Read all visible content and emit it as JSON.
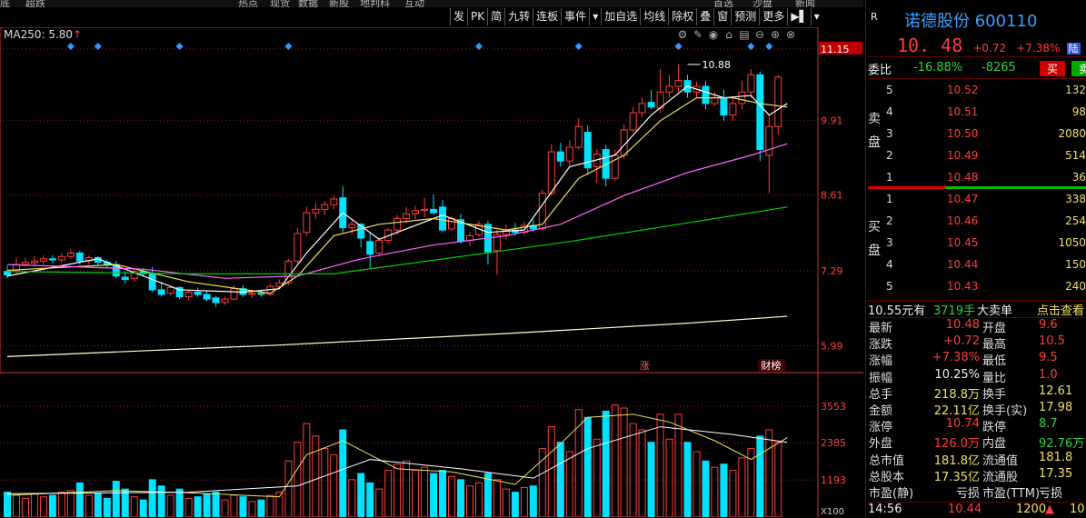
{
  "top_strip": [
    "底",
    "超跌",
    "热点",
    "现货",
    "数据",
    "新股",
    "地判科",
    "互动",
    "首选",
    "沙盘",
    "新闻"
  ],
  "toolbar": [
    {
      "id": "fa",
      "label": "发"
    },
    {
      "id": "pk",
      "label": "PK"
    },
    {
      "id": "jian",
      "label": "简"
    },
    {
      "id": "jiuzhuan",
      "label": "九转"
    },
    {
      "id": "lianban",
      "label": "连板"
    },
    {
      "id": "shijian",
      "label": "事件"
    },
    {
      "id": "menu",
      "label": "▾"
    },
    {
      "id": "jiazixuan",
      "label": "加自选"
    },
    {
      "id": "junxian",
      "label": "均线"
    },
    {
      "id": "chuquan",
      "label": "除权"
    },
    {
      "id": "die",
      "label": "叠"
    },
    {
      "id": "chuang",
      "label": "窗"
    },
    {
      "id": "yuce",
      "label": "预测"
    },
    {
      "id": "gengduo",
      "label": "更多"
    },
    {
      "id": "expand",
      "label": "▶▌"
    },
    {
      "id": "dropdown",
      "label": "▾"
    }
  ],
  "ma250_label": "MA250: 5.80",
  "ma250_arrow": "↑",
  "chart_controls": [
    "gear-icon",
    "pen-icon",
    "eye-icon",
    "lock-icon",
    "print-icon",
    "minus-icon",
    "plus-icon",
    "close-icon"
  ],
  "colors": {
    "up": "#ff3c3c",
    "down": "#00e0ff",
    "ma5": "#ffffff",
    "ma10": "#f0e060",
    "ma20": "#ff66ff",
    "ma60": "#00d000",
    "ma250": "#ffffcc",
    "grid": "#9a2020",
    "axis": "#cc3333"
  },
  "chart_data": {
    "type": "candlestick",
    "price_ticks": [
      11.15,
      9.91,
      8.61,
      7.29,
      5.99
    ],
    "price_range": [
      5.6,
      11.4
    ],
    "volume_ticks": [
      3553,
      2385,
      1193
    ],
    "volume_unit": "X100",
    "volume_range": [
      0,
      4200
    ],
    "high_marker": "10.88",
    "annotations": [
      "涨",
      "财榜"
    ],
    "candles": [
      {
        "o": 7.28,
        "h": 7.38,
        "l": 7.16,
        "c": 7.22,
        "v": 800
      },
      {
        "o": 7.3,
        "h": 7.52,
        "l": 7.24,
        "c": 7.4,
        "v": 700
      },
      {
        "o": 7.4,
        "h": 7.52,
        "l": 7.36,
        "c": 7.44,
        "v": 600
      },
      {
        "o": 7.43,
        "h": 7.55,
        "l": 7.38,
        "c": 7.46,
        "v": 750
      },
      {
        "o": 7.46,
        "h": 7.56,
        "l": 7.4,
        "c": 7.5,
        "v": 650
      },
      {
        "o": 7.5,
        "h": 7.56,
        "l": 7.42,
        "c": 7.48,
        "v": 700
      },
      {
        "o": 7.48,
        "h": 7.6,
        "l": 7.44,
        "c": 7.54,
        "v": 800
      },
      {
        "o": 7.54,
        "h": 7.66,
        "l": 7.5,
        "c": 7.6,
        "v": 850
      },
      {
        "o": 7.6,
        "h": 7.64,
        "l": 7.4,
        "c": 7.46,
        "v": 1100
      },
      {
        "o": 7.47,
        "h": 7.56,
        "l": 7.4,
        "c": 7.52,
        "v": 700
      },
      {
        "o": 7.52,
        "h": 7.54,
        "l": 7.38,
        "c": 7.44,
        "v": 750
      },
      {
        "o": 7.44,
        "h": 7.48,
        "l": 7.34,
        "c": 7.4,
        "v": 600
      },
      {
        "o": 7.4,
        "h": 7.46,
        "l": 7.16,
        "c": 7.2,
        "v": 1150
      },
      {
        "o": 7.18,
        "h": 7.28,
        "l": 7.06,
        "c": 7.14,
        "v": 900
      },
      {
        "o": 7.16,
        "h": 7.34,
        "l": 7.1,
        "c": 7.28,
        "v": 650
      },
      {
        "o": 7.28,
        "h": 7.34,
        "l": 7.2,
        "c": 7.24,
        "v": 550
      },
      {
        "o": 7.24,
        "h": 7.36,
        "l": 6.92,
        "c": 6.96,
        "v": 1200
      },
      {
        "o": 6.96,
        "h": 7.1,
        "l": 6.84,
        "c": 6.88,
        "v": 1000
      },
      {
        "o": 6.9,
        "h": 7.04,
        "l": 6.86,
        "c": 7.0,
        "v": 700
      },
      {
        "o": 7.0,
        "h": 7.02,
        "l": 6.8,
        "c": 6.84,
        "v": 900
      },
      {
        "o": 6.84,
        "h": 6.96,
        "l": 6.78,
        "c": 6.92,
        "v": 600
      },
      {
        "o": 6.92,
        "h": 7.0,
        "l": 6.84,
        "c": 6.88,
        "v": 650
      },
      {
        "o": 6.88,
        "h": 6.94,
        "l": 6.76,
        "c": 6.8,
        "v": 750
      },
      {
        "o": 6.82,
        "h": 6.86,
        "l": 6.66,
        "c": 6.74,
        "v": 800
      },
      {
        "o": 6.74,
        "h": 6.84,
        "l": 6.7,
        "c": 6.8,
        "v": 550
      },
      {
        "o": 6.8,
        "h": 7.04,
        "l": 6.78,
        "c": 6.98,
        "v": 700
      },
      {
        "o": 6.98,
        "h": 7.04,
        "l": 6.84,
        "c": 6.88,
        "v": 650
      },
      {
        "o": 6.88,
        "h": 6.96,
        "l": 6.82,
        "c": 6.9,
        "v": 500
      },
      {
        "o": 6.9,
        "h": 6.96,
        "l": 6.84,
        "c": 6.88,
        "v": 550
      },
      {
        "o": 6.88,
        "h": 7.06,
        "l": 6.86,
        "c": 7.02,
        "v": 700
      },
      {
        "o": 7.02,
        "h": 7.14,
        "l": 6.98,
        "c": 7.08,
        "v": 800
      },
      {
        "o": 7.08,
        "h": 7.5,
        "l": 7.04,
        "c": 7.46,
        "v": 1800
      },
      {
        "o": 7.46,
        "h": 8.04,
        "l": 7.42,
        "c": 7.94,
        "v": 2400
      },
      {
        "o": 7.96,
        "h": 8.4,
        "l": 7.9,
        "c": 8.3,
        "v": 3000
      },
      {
        "o": 8.3,
        "h": 8.48,
        "l": 8.2,
        "c": 8.36,
        "v": 2600
      },
      {
        "o": 8.36,
        "h": 8.5,
        "l": 8.26,
        "c": 8.44,
        "v": 2200
      },
      {
        "o": 8.44,
        "h": 8.6,
        "l": 8.36,
        "c": 8.54,
        "v": 2000
      },
      {
        "o": 8.56,
        "h": 8.76,
        "l": 7.96,
        "c": 8.04,
        "v": 2800
      },
      {
        "o": 8.04,
        "h": 8.18,
        "l": 7.92,
        "c": 8.1,
        "v": 1200
      },
      {
        "o": 8.1,
        "h": 8.12,
        "l": 7.7,
        "c": 7.86,
        "v": 1400
      },
      {
        "o": 7.8,
        "h": 7.94,
        "l": 7.34,
        "c": 7.58,
        "v": 1100
      },
      {
        "o": 7.6,
        "h": 7.86,
        "l": 7.56,
        "c": 7.82,
        "v": 900
      },
      {
        "o": 7.82,
        "h": 8.04,
        "l": 7.76,
        "c": 8.0,
        "v": 1500
      },
      {
        "o": 8.0,
        "h": 8.26,
        "l": 7.92,
        "c": 8.2,
        "v": 1700
      },
      {
        "o": 8.2,
        "h": 8.4,
        "l": 8.12,
        "c": 8.28,
        "v": 1800
      },
      {
        "o": 8.28,
        "h": 8.42,
        "l": 8.18,
        "c": 8.34,
        "v": 1500
      },
      {
        "o": 8.34,
        "h": 8.56,
        "l": 8.22,
        "c": 8.36,
        "v": 1600
      },
      {
        "o": 8.36,
        "h": 8.62,
        "l": 8.26,
        "c": 8.3,
        "v": 1400
      },
      {
        "o": 8.4,
        "h": 8.52,
        "l": 7.96,
        "c": 8.0,
        "v": 1500
      },
      {
        "o": 8.02,
        "h": 8.24,
        "l": 7.98,
        "c": 8.2,
        "v": 1300
      },
      {
        "o": 8.18,
        "h": 8.28,
        "l": 7.76,
        "c": 7.8,
        "v": 1200
      },
      {
        "o": 7.82,
        "h": 7.96,
        "l": 7.72,
        "c": 7.9,
        "v": 1000
      },
      {
        "o": 7.92,
        "h": 8.16,
        "l": 7.88,
        "c": 8.1,
        "v": 1100
      },
      {
        "o": 8.1,
        "h": 8.16,
        "l": 7.4,
        "c": 7.62,
        "v": 1400
      },
      {
        "o": 7.64,
        "h": 8.0,
        "l": 7.22,
        "c": 7.92,
        "v": 1200
      },
      {
        "o": 7.92,
        "h": 8.1,
        "l": 7.84,
        "c": 8.0,
        "v": 900
      },
      {
        "o": 8.0,
        "h": 8.12,
        "l": 7.9,
        "c": 7.96,
        "v": 800
      },
      {
        "o": 7.96,
        "h": 8.14,
        "l": 7.9,
        "c": 8.08,
        "v": 950
      },
      {
        "o": 8.08,
        "h": 8.18,
        "l": 7.96,
        "c": 8.02,
        "v": 1000
      },
      {
        "o": 8.02,
        "h": 8.7,
        "l": 7.98,
        "c": 8.64,
        "v": 2200
      },
      {
        "o": 8.64,
        "h": 9.5,
        "l": 8.6,
        "c": 9.36,
        "v": 2900
      },
      {
        "o": 9.36,
        "h": 9.52,
        "l": 9.1,
        "c": 9.2,
        "v": 2400
      },
      {
        "o": 9.2,
        "h": 9.56,
        "l": 9.12,
        "c": 9.44,
        "v": 2100
      },
      {
        "o": 9.44,
        "h": 9.94,
        "l": 9.4,
        "c": 9.8,
        "v": 3450
      },
      {
        "o": 9.7,
        "h": 9.82,
        "l": 8.96,
        "c": 9.08,
        "v": 3200
      },
      {
        "o": 9.1,
        "h": 9.4,
        "l": 8.82,
        "c": 9.32,
        "v": 2500
      },
      {
        "o": 9.4,
        "h": 9.48,
        "l": 8.76,
        "c": 8.9,
        "v": 3400
      },
      {
        "o": 8.9,
        "h": 9.4,
        "l": 8.86,
        "c": 9.3,
        "v": 3600
      },
      {
        "o": 9.3,
        "h": 9.84,
        "l": 9.24,
        "c": 9.74,
        "v": 3500
      },
      {
        "o": 9.74,
        "h": 10.14,
        "l": 9.7,
        "c": 10.04,
        "v": 3000
      },
      {
        "o": 10.04,
        "h": 10.3,
        "l": 9.96,
        "c": 10.2,
        "v": 2800
      },
      {
        "o": 10.22,
        "h": 10.44,
        "l": 10.1,
        "c": 10.14,
        "v": 2400
      },
      {
        "o": 10.12,
        "h": 10.8,
        "l": 10.04,
        "c": 10.4,
        "v": 3300
      },
      {
        "o": 10.4,
        "h": 10.7,
        "l": 10.3,
        "c": 10.5,
        "v": 2500
      },
      {
        "o": 10.5,
        "h": 10.88,
        "l": 10.4,
        "c": 10.6,
        "v": 3300
      },
      {
        "o": 10.6,
        "h": 10.7,
        "l": 10.3,
        "c": 10.4,
        "v": 2400
      },
      {
        "o": 10.4,
        "h": 10.58,
        "l": 10.3,
        "c": 10.5,
        "v": 2100
      },
      {
        "o": 10.5,
        "h": 10.6,
        "l": 10.1,
        "c": 10.2,
        "v": 1800
      },
      {
        "o": 10.2,
        "h": 10.4,
        "l": 10.16,
        "c": 10.3,
        "v": 1600
      },
      {
        "o": 10.3,
        "h": 10.44,
        "l": 9.9,
        "c": 10.0,
        "v": 1700
      },
      {
        "o": 10.0,
        "h": 10.3,
        "l": 9.9,
        "c": 10.2,
        "v": 1500
      },
      {
        "o": 10.2,
        "h": 10.6,
        "l": 10.1,
        "c": 10.4,
        "v": 1900
      },
      {
        "o": 10.4,
        "h": 10.8,
        "l": 10.3,
        "c": 10.7,
        "v": 2200
      },
      {
        "o": 10.7,
        "h": 10.76,
        "l": 9.2,
        "c": 9.4,
        "v": 2600
      },
      {
        "o": 9.3,
        "h": 10.0,
        "l": 8.64,
        "c": 9.8,
        "v": 2800
      },
      {
        "o": 9.8,
        "h": 10.7,
        "l": 9.66,
        "c": 10.66,
        "v": 2400
      }
    ],
    "ma_lines": {
      "ma5": [
        [
          0,
          7.2
        ],
        [
          10,
          7.5
        ],
        [
          19,
          6.96
        ],
        [
          26,
          6.92
        ],
        [
          30,
          6.98
        ],
        [
          33,
          7.6
        ],
        [
          37,
          8.3
        ],
        [
          41,
          7.84
        ],
        [
          48,
          8.26
        ],
        [
          53,
          7.96
        ],
        [
          57,
          8.0
        ],
        [
          62,
          9.1
        ],
        [
          67,
          9.3
        ],
        [
          71,
          10.0
        ],
        [
          75,
          10.5
        ],
        [
          79,
          10.3
        ],
        [
          82,
          10.34
        ],
        [
          84,
          10.0
        ],
        [
          86,
          10.2
        ]
      ],
      "ma10": [
        [
          0,
          7.3
        ],
        [
          12,
          7.4
        ],
        [
          20,
          7.1
        ],
        [
          29,
          6.9
        ],
        [
          32,
          7.2
        ],
        [
          36,
          7.9
        ],
        [
          41,
          8.1
        ],
        [
          47,
          8.2
        ],
        [
          55,
          8.0
        ],
        [
          59,
          8.1
        ],
        [
          63,
          8.9
        ],
        [
          68,
          9.3
        ],
        [
          72,
          9.9
        ],
        [
          76,
          10.3
        ],
        [
          80,
          10.3
        ],
        [
          83,
          10.2
        ],
        [
          86,
          10.14
        ]
      ],
      "ma20": [
        [
          0,
          7.4
        ],
        [
          15,
          7.32
        ],
        [
          24,
          7.16
        ],
        [
          32,
          7.2
        ],
        [
          39,
          7.5
        ],
        [
          47,
          7.74
        ],
        [
          55,
          7.9
        ],
        [
          61,
          8.1
        ],
        [
          68,
          8.6
        ],
        [
          75,
          9.0
        ],
        [
          82,
          9.3
        ],
        [
          86,
          9.5
        ]
      ],
      "ma60": [
        [
          0,
          7.28
        ],
        [
          20,
          7.24
        ],
        [
          36,
          7.24
        ],
        [
          50,
          7.54
        ],
        [
          62,
          7.8
        ],
        [
          74,
          8.1
        ],
        [
          86,
          8.4
        ]
      ],
      "ma250": [
        [
          0,
          5.8
        ],
        [
          30,
          6.0
        ],
        [
          55,
          6.2
        ],
        [
          75,
          6.38
        ],
        [
          86,
          6.5
        ]
      ],
      "vol_ma5": [
        [
          0,
          700
        ],
        [
          12,
          850
        ],
        [
          20,
          780
        ],
        [
          30,
          650
        ],
        [
          33,
          2000
        ],
        [
          37,
          2450
        ],
        [
          43,
          1550
        ],
        [
          49,
          1450
        ],
        [
          56,
          1050
        ],
        [
          61,
          2350
        ],
        [
          64,
          3200
        ],
        [
          69,
          3300
        ],
        [
          73,
          3050
        ],
        [
          78,
          2450
        ],
        [
          82,
          1850
        ],
        [
          86,
          2550
        ]
      ],
      "vol_ma10": [
        [
          0,
          750
        ],
        [
          20,
          800
        ],
        [
          32,
          1000
        ],
        [
          40,
          1850
        ],
        [
          50,
          1550
        ],
        [
          58,
          1250
        ],
        [
          64,
          2200
        ],
        [
          72,
          2900
        ],
        [
          80,
          2650
        ],
        [
          86,
          2400
        ]
      ]
    },
    "diamond_markers": [
      7,
      10,
      19,
      31,
      52,
      63,
      74,
      82,
      84
    ]
  },
  "stock": {
    "flag": "R",
    "name": "诺德股份",
    "code": "600110",
    "price": "10. 48",
    "change": "+0.72",
    "pct": "+7.38%",
    "market": "陆"
  },
  "weibi": {
    "label": "委比",
    "ratio": "-16.88%",
    "diff": "-8265",
    "buy_btn": "买",
    "sell_btn": "卖"
  },
  "sell_side_label": [
    "卖",
    "盘"
  ],
  "buy_side_label": [
    "买",
    "盘"
  ],
  "asks": [
    {
      "lv": "5",
      "price": "10.52",
      "vol": "132"
    },
    {
      "lv": "4",
      "price": "10.51",
      "vol": "98"
    },
    {
      "lv": "3",
      "price": "10.50",
      "vol": "2080"
    },
    {
      "lv": "2",
      "price": "10.49",
      "vol": "514"
    },
    {
      "lv": "1",
      "price": "10.48",
      "vol": "36"
    }
  ],
  "bids": [
    {
      "lv": "1",
      "price": "10.47",
      "vol": "338"
    },
    {
      "lv": "2",
      "price": "10.46",
      "vol": "254"
    },
    {
      "lv": "3",
      "price": "10.45",
      "vol": "1050"
    },
    {
      "lv": "4",
      "price": "10.44",
      "vol": "150"
    },
    {
      "lv": "5",
      "price": "10.43",
      "vol": "240"
    }
  ],
  "deal": {
    "amount": "10.55元有",
    "hands": "3719手",
    "big": "大卖单",
    "link": "点击查看"
  },
  "quote": [
    {
      "k1": "最新",
      "v1": "10.48",
      "c1": "red",
      "k2": "开盘",
      "v2": "9.6",
      "c2": "red"
    },
    {
      "k1": "涨跌",
      "v1": "+0.72",
      "c1": "red",
      "k2": "最高",
      "v2": "10.5",
      "c2": "red"
    },
    {
      "k1": "涨幅",
      "v1": "+7.38%",
      "c1": "red",
      "k2": "最低",
      "v2": "9.5",
      "c2": "red"
    },
    {
      "k1": "振幅",
      "v1": "10.25%",
      "c1": "white",
      "k2": "量比",
      "v2": "1.0",
      "c2": "red"
    },
    {
      "k1": "总手",
      "v1": "218.8万",
      "c1": "yellow",
      "k2": "换手",
      "v2": "12.61",
      "c2": "yellow"
    },
    {
      "k1": "金额",
      "v1": "22.11亿",
      "c1": "yellow",
      "k2": "换手(实)",
      "v2": "17.98",
      "c2": "yellow"
    },
    {
      "k1": "涨停",
      "v1": "10.74",
      "c1": "red",
      "k2": "跌停",
      "v2": "8.7",
      "c2": "green"
    },
    {
      "k1": "外盘",
      "v1": "126.0万",
      "c1": "red",
      "k2": "内盘",
      "v2": "92.76万",
      "c2": "green"
    },
    {
      "k1": "总市值",
      "v1": "181.8亿",
      "c1": "yellow",
      "k2": "流通值",
      "v2": "181.8",
      "c2": "yellow"
    },
    {
      "k1": "总股本",
      "v1": "17.35亿",
      "c1": "yellow",
      "k2": "流通股",
      "v2": "17.35",
      "c2": "yellow"
    },
    {
      "k1": "市盈(静)",
      "v1": "亏损",
      "c1": "white",
      "k2": "市盈(TTM)",
      "v2": "亏损",
      "c2": "white"
    }
  ],
  "bottom": {
    "time": "14:56",
    "price": "10.44",
    "vol": "1200",
    "arrow": "▲",
    "extra": "10"
  }
}
